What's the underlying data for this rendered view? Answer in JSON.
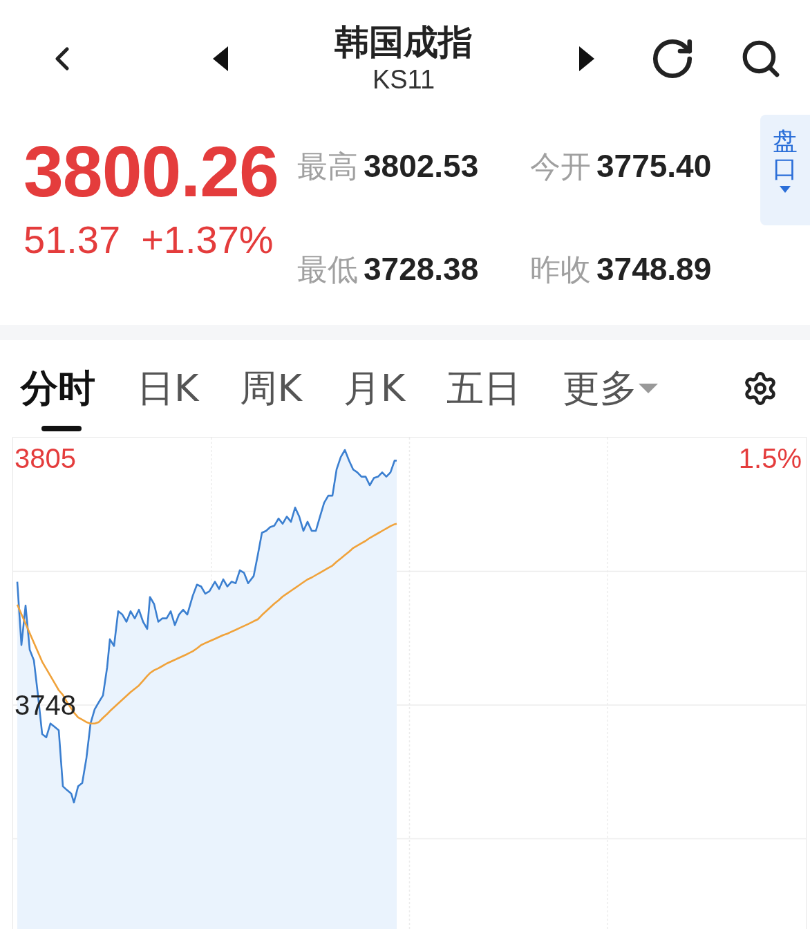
{
  "header": {
    "title": "韩国成指",
    "code": "KS11"
  },
  "quote": {
    "price": "3800.26",
    "change": "51.37",
    "change_pct": "+1.37%",
    "stats": [
      {
        "label": "最高",
        "value": "3802.53"
      },
      {
        "label": "今开",
        "value": "3775.40"
      },
      {
        "label": "最低",
        "value": "3728.38"
      },
      {
        "label": "昨收",
        "value": "3748.89"
      }
    ]
  },
  "side_tab": {
    "label": "盘口"
  },
  "tabs": [
    {
      "label": "分时",
      "selected": true,
      "kind": "plain"
    },
    {
      "label": "日K",
      "selected": false,
      "kind": "plain"
    },
    {
      "label": "周K",
      "selected": false,
      "kind": "plain"
    },
    {
      "label": "月K",
      "selected": false,
      "kind": "plain"
    },
    {
      "label": "五日",
      "selected": false,
      "kind": "plain"
    },
    {
      "label": "更多",
      "selected": false,
      "kind": "dropdown"
    }
  ],
  "chart": {
    "axis_labels": [
      {
        "text": "3805",
        "kind": "top"
      },
      {
        "text": "3748",
        "kind": "middle"
      }
    ],
    "right_label": "1.5%"
  }
}
